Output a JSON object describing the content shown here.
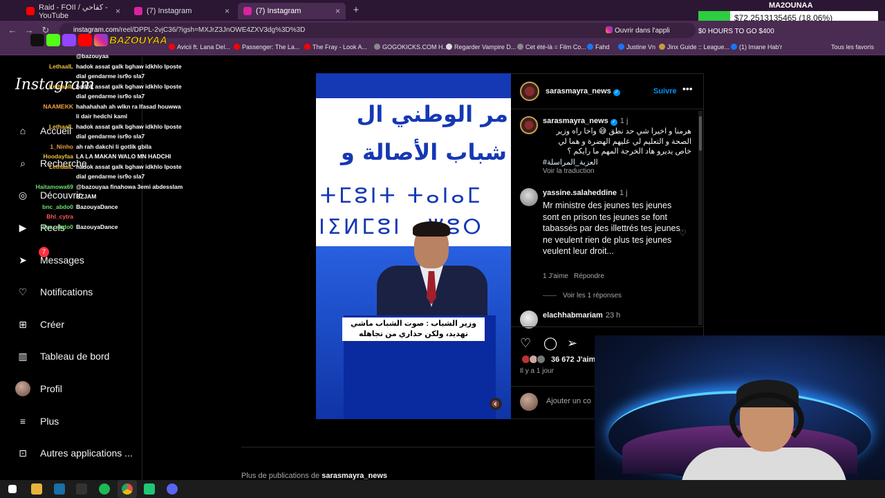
{
  "browser": {
    "tabs": [
      {
        "label": "Raid - FOII / كفاحي - YouTube",
        "color": "#ff0000"
      },
      {
        "label": "(7) Instagram",
        "color": "#d6249f"
      },
      {
        "label": "(7) Instagram",
        "color": "#d6249f"
      }
    ],
    "url_main": "instagram.com",
    "url_rest": "/reel/DPPL-2vjC36/?igsh=MXJrZ3JnOWE4ZXV3dg%3D%3D",
    "open_in_app": "Ouvrir dans l'appli",
    "bookmarks": [
      {
        "label": "Avicii ft. Lana Del...",
        "color": "#ff0000"
      },
      {
        "label": "Passenger: The La...",
        "color": "#ff0000"
      },
      {
        "label": "The Fray - Look A...",
        "color": "#ff0000"
      },
      {
        "label": "GOGOKICKS.COM H...",
        "color": "#888888"
      },
      {
        "label": "Regarder Vampire D...",
        "color": "#dddddd"
      },
      {
        "label": "Cet été-là = Film Co...",
        "color": "#888888"
      },
      {
        "label": "Fahd",
        "color": "#1877f2"
      },
      {
        "label": "Justine Vn",
        "color": "#1877f2"
      },
      {
        "label": "Jinx Guide :: League...",
        "color": "#c89b3c"
      },
      {
        "label": "(1) Imane Hab'r",
        "color": "#1877f2"
      }
    ],
    "all_bookmarks": "Tous les favoris"
  },
  "stream": {
    "name": "MA2OUNAA",
    "ticker": "$72.2513135465 (18.06%)",
    "icons_text": "$0   HOURS TO GO   $400",
    "brand": "BAZOUYAA"
  },
  "chat": [
    {
      "user": "",
      "msg": "@bazouyaa",
      "color": "#ffffff"
    },
    {
      "user": "LethaalL",
      "msg": "hadok assat galk bghaw idkhlo lposte",
      "color": "#f0c040"
    },
    {
      "user": "",
      "msg": "dial gendarme isr9o sla7",
      "color": "#ffffff"
    },
    {
      "user": "LethaalL",
      "msg": "hadok assat galk bghaw idkhlo lposte",
      "color": "#f0c040"
    },
    {
      "user": "",
      "msg": "dial gendarme isr9o sla7",
      "color": "#ffffff"
    },
    {
      "user": "NAAMEKK",
      "msg": "hahahahah ah wlkn ra lfasad houwwa",
      "color": "#f0a040"
    },
    {
      "user": "",
      "msg": "li dair hedchi kaml",
      "color": "#ffffff"
    },
    {
      "user": "LethaalL",
      "msg": "hadok assat galk bghaw idkhlo lposte",
      "color": "#f0c040"
    },
    {
      "user": "",
      "msg": "dial gendarme isr9o sla7",
      "color": "#ffffff"
    },
    {
      "user": "1_Ninho",
      "msg": "ah rah dakchi li gotlik gbila",
      "color": "#f0a040"
    },
    {
      "user": "Hoodayfaa",
      "msg": "LA LA MAKAN WALO MN HADCHI",
      "color": "#f0c040"
    },
    {
      "user": "LethaalL",
      "msg": "hadok assat galk bghaw idkhlo lposte",
      "color": "#f0c040"
    },
    {
      "user": "",
      "msg": "dial gendarme isr9o sla7",
      "color": "#ffffff"
    },
    {
      "user": "Haitamowa69",
      "msg": "@bazouyaa finahowa 3emi abdesslam",
      "color": "#6ee06e"
    },
    {
      "user": "",
      "msg": "BZJAM",
      "color": "#ffffff"
    },
    {
      "user": "bnc_abdo0",
      "msg": "BazouyaDance",
      "color": "#6ee06e"
    },
    {
      "user": "Bhl_cytra",
      "msg": "",
      "color": "#ff5a5a"
    },
    {
      "user": "bnc_abdo0",
      "msg": "BazouyaDance",
      "color": "#6ee06e"
    }
  ],
  "ig": {
    "logo": "Instagram",
    "nav": [
      {
        "key": "home",
        "label": "Accueil",
        "icon": "⌂"
      },
      {
        "key": "search",
        "label": "Recherche",
        "icon": "⌕"
      },
      {
        "key": "explore",
        "label": "Découvrir",
        "icon": "◎"
      },
      {
        "key": "reels",
        "label": "Reels",
        "icon": "▶"
      },
      {
        "key": "messages",
        "label": "Messages",
        "icon": "➤",
        "badge": "7"
      },
      {
        "key": "notifications",
        "label": "Notifications",
        "icon": "♡"
      },
      {
        "key": "create",
        "label": "Créer",
        "icon": "⊞"
      },
      {
        "key": "dashboard",
        "label": "Tableau de bord",
        "icon": "▥"
      },
      {
        "key": "profile",
        "label": "Profil",
        "icon": ""
      },
      {
        "key": "more",
        "label": "Plus",
        "icon": "≡"
      },
      {
        "key": "apps",
        "label": "Autres applications ...",
        "icon": "⊡"
      }
    ]
  },
  "post": {
    "author": "sarasmayra_news",
    "follow": "Suivre",
    "video": {
      "arabic_line1": "مر الوطني ال",
      "arabic_line2": "شباب الأصالة و",
      "amazigh_line1": "ⵜⵎⵓⵏⵜ ⵜⴰⵏⴰⵎ",
      "amazigh_line2": "ⵏⵉⵍⵎⵓⵏ ⴰⵥⵓⵔ",
      "caption": "وزير الشباب : صوت الشباب ماشي تهديد، ولكن حذاري من تجاهله"
    },
    "caption_comment": {
      "user": "sarasmayra_news",
      "time": "1 j",
      "text": "هرمنا و اخيرا شي حد نطق 😅 واخا راه وزير الصحة و التعليم لي عليهم الهضرة و هما لي خاص يديرو هاد الخرجة المهم ما رايكم ؟",
      "hashtag": "#العزبة_المراسلة",
      "translate": "Voir la traduction"
    },
    "comments": [
      {
        "user": "yassine.salaheddine",
        "time": "1 j",
        "text": "Mr ministre des jeunes tes jeunes sont en prison tes jeunes se font tabassés par des illettrés tes jeunes ne veulent rien de plus tes jeunes veulent leur droit...",
        "likes": "1 J'aime",
        "reply": "Répondre",
        "replies": "Voir les 1 réponses"
      },
      {
        "user": "elachhabmariam",
        "time": "23 h"
      }
    ],
    "likes": "36 672 J'aim",
    "posted": "Il y a 1 jour",
    "add_comment": "Ajouter un co",
    "more_from_prefix": "Plus de publications de",
    "more_from_user": "sarasmayra_news"
  }
}
